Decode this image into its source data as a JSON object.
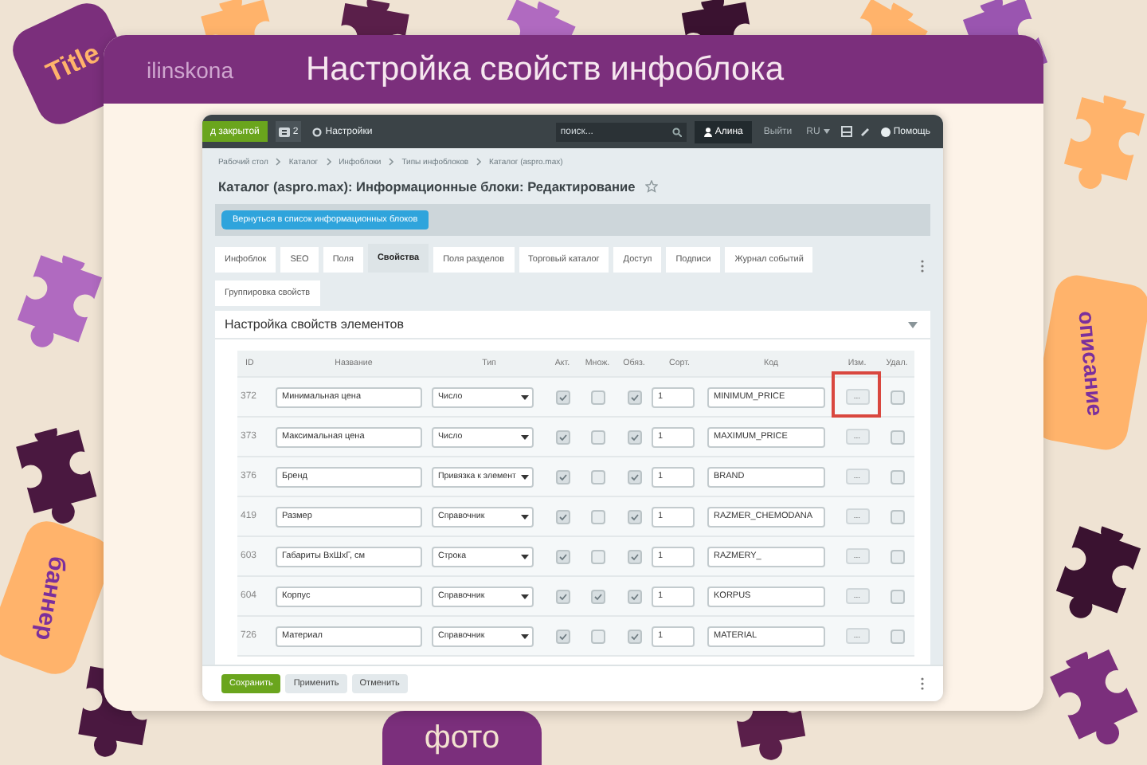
{
  "banner": {
    "brand": "ilinskona",
    "title": "Настройка свойств инфоблока",
    "stickers": [
      {
        "text": "Title"
      },
      {
        "text": "баннер"
      },
      {
        "text": "описание"
      },
      {
        "text": "фото"
      }
    ]
  },
  "app": {
    "topbar": {
      "green_button": "д закрытой",
      "counter": "2",
      "settings": "Настройки",
      "search": {
        "placeholder": "поиск..."
      },
      "user": "Алина",
      "logout": "Выйти",
      "language": "RU",
      "help": "Помощь"
    },
    "breadcrumbs": [
      "Рабочий стол",
      "Каталог",
      "Инфоблоки",
      "Типы инфоблоков",
      "Каталог (aspro.max)"
    ],
    "page_title": "Каталог (aspro.max): Информационные блоки: Редактирование",
    "back_button": "Вернуться в список информационных блоков",
    "tabs": [
      {
        "label": "Инфоблок",
        "selected": false
      },
      {
        "label": "SEO",
        "selected": false
      },
      {
        "label": "Поля",
        "selected": false
      },
      {
        "label": "Свойства",
        "selected": true
      },
      {
        "label": "Поля разделов",
        "selected": false
      },
      {
        "label": "Торговый каталог",
        "selected": false
      },
      {
        "label": "Доступ",
        "selected": false
      },
      {
        "label": "Подписи",
        "selected": false
      },
      {
        "label": "Журнал событий",
        "selected": false
      }
    ],
    "subtabs": [
      {
        "label": "Группировка свойств",
        "selected": false
      }
    ],
    "section_title": "Настройка свойств элементов",
    "table": {
      "columns": [
        "ID",
        "Название",
        "Тип",
        "Акт.",
        "Множ.",
        "Обяз.",
        "Сорт.",
        "Код",
        "Изм.",
        "Удал."
      ],
      "rows": [
        {
          "id": "372",
          "name": "Минимальная цена",
          "type": "Число",
          "active": true,
          "multiple": false,
          "required": true,
          "sort": "1",
          "code": "MINIMUM_PRICE",
          "edit": "...",
          "delete": false,
          "highlighted": true
        },
        {
          "id": "373",
          "name": "Максимальная цена",
          "type": "Число",
          "active": true,
          "multiple": false,
          "required": true,
          "sort": "1",
          "code": "MAXIMUM_PRICE",
          "edit": "...",
          "delete": false,
          "highlighted": false
        },
        {
          "id": "376",
          "name": "Бренд",
          "type": "Привязка к элемент",
          "active": true,
          "multiple": false,
          "required": true,
          "sort": "1",
          "code": "BRAND",
          "edit": "...",
          "delete": false,
          "highlighted": false
        },
        {
          "id": "419",
          "name": "Размер",
          "type": "Справочник",
          "active": true,
          "multiple": false,
          "required": true,
          "sort": "1",
          "code": "RAZMER_CHEMODANA",
          "edit": "...",
          "delete": false,
          "highlighted": false
        },
        {
          "id": "603",
          "name": "Габариты ВxШxГ, см",
          "type": "Строка",
          "active": true,
          "multiple": false,
          "required": true,
          "sort": "1",
          "code": "RAZMERY_",
          "edit": "...",
          "delete": false,
          "highlighted": false
        },
        {
          "id": "604",
          "name": "Корпус",
          "type": "Справочник",
          "active": true,
          "multiple": true,
          "required": true,
          "sort": "1",
          "code": "KORPUS",
          "edit": "...",
          "delete": false,
          "highlighted": false
        },
        {
          "id": "726",
          "name": "Материал",
          "type": "Справочник",
          "active": true,
          "multiple": false,
          "required": true,
          "sort": "1",
          "code": "MATERIAL",
          "edit": "...",
          "delete": false,
          "highlighted": false
        }
      ]
    },
    "footer_buttons": [
      {
        "label": "Сохранить",
        "kind": "primary"
      },
      {
        "label": "Применить",
        "kind": "plain"
      },
      {
        "label": "Отменить",
        "kind": "plain"
      }
    ]
  }
}
